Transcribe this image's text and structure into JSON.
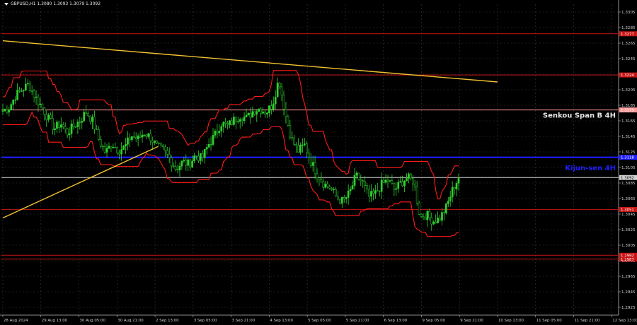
{
  "window": {
    "title": "GBPUSD,H1  1.3080 1.3093 1.3079 1.3092"
  },
  "colors": {
    "background": "#000000",
    "grid": "#3a3a3a",
    "candle": "#2fd12f",
    "kijun_line": "#1e1eff",
    "senkou_line": "#ff9a9a",
    "level_line": "#c81414",
    "trend_line": "#f2c230",
    "channel": "#ff1a1a",
    "label_bg": "#c81414",
    "axis_text": "#d0d0d0"
  },
  "chart_data": {
    "type": "candlestick",
    "symbol": "GBPUSD",
    "timeframe": "H1",
    "ohlc_header": {
      "open": 1.308,
      "high": 1.3093,
      "low": 1.3079,
      "close": 1.3092
    },
    "ylim": [
      1.2915,
      1.3315
    ],
    "y_ticks": [
      "1.3305",
      "1.3285",
      "1.3265",
      "1.3245",
      "1.3225",
      "1.3205",
      "1.3185",
      "1.3165",
      "1.3145",
      "1.3125",
      "1.3105",
      "1.3085",
      "1.3065",
      "1.3045",
      "1.3025",
      "1.3005",
      "1.2985",
      "1.2965",
      "1.2945",
      "1.2925"
    ],
    "x_ticks": [
      "28 Aug 2024",
      "29 Aug 13:00",
      "30 Aug 05:00",
      "30 Aug 21:00",
      "2 Sep 13:00",
      "3 Sep 05:00",
      "3 Sep 21:00",
      "4 Sep 13:00",
      "5 Sep 05:00",
      "5 Sep 21:00",
      "6 Sep 13:00",
      "9 Sep 05:00",
      "9 Sep 21:00",
      "10 Sep 13:00",
      "11 Sep 05:00",
      "11 Sep 21:00",
      "12 Sep 13:00"
    ],
    "close_path": [
      1.3178,
      1.3182,
      1.3198,
      1.3205,
      1.3212,
      1.3196,
      1.3184,
      1.3169,
      1.3155,
      1.3162,
      1.3149,
      1.3158,
      1.3165,
      1.3177,
      1.3164,
      1.3139,
      1.3124,
      1.3136,
      1.3127,
      1.3131,
      1.3146,
      1.3141,
      1.315,
      1.3144,
      1.3132,
      1.3127,
      1.3116,
      1.3103,
      1.3112,
      1.3109,
      1.3121,
      1.3116,
      1.3134,
      1.3146,
      1.3162,
      1.3158,
      1.3166,
      1.3172,
      1.3168,
      1.3178,
      1.3181,
      1.3176,
      1.3186,
      1.3219,
      1.3174,
      1.3141,
      1.3126,
      1.3134,
      1.3112,
      1.3096,
      1.3084,
      1.3079,
      1.3066,
      1.3061,
      1.3072,
      1.3094,
      1.3086,
      1.3067,
      1.3071,
      1.3083,
      1.3089,
      1.3076,
      1.3085,
      1.3092,
      1.3087,
      1.3041,
      1.3044,
      1.3036,
      1.3039,
      1.3052,
      1.3075,
      1.3092
    ],
    "candles_count": 220,
    "horizontal_levels": [
      {
        "price": 1.3277,
        "label": "1.3277",
        "color": "#c81414"
      },
      {
        "price": 1.3224,
        "label": "1.3224",
        "color": "#c81414"
      },
      {
        "price": 1.3179,
        "label": "1.3179",
        "color": "#ff9a9a"
      },
      {
        "price": 1.3118,
        "label": "1.3118",
        "color": "#1e1eff"
      },
      {
        "price": 1.3092,
        "label": "1.3092",
        "color": "#cfcfcf"
      },
      {
        "price": 1.3051,
        "label": "1.3051",
        "color": "#c81414"
      },
      {
        "price": 1.2992,
        "label": "1.2992",
        "color": "#c81414"
      },
      {
        "price": 1.2987,
        "label": "1.2987",
        "color": "#c81414"
      }
    ],
    "annotations": [
      {
        "text": "Senkou Span B 4H",
        "price": 1.3172,
        "color": "#e6e6e6"
      },
      {
        "text": "Kijun-sen 4H",
        "price": 1.3104,
        "color": "#1e1eff"
      }
    ],
    "trend_lines": [
      {
        "from": {
          "x_index": 0,
          "price": 1.3268
        },
        "to": {
          "x_index": 0.78,
          "price": 1.3215
        }
      },
      {
        "from": {
          "x_index": 0,
          "price": 1.304
        },
        "to": {
          "x_index": 0.245,
          "price": 1.3132
        }
      }
    ]
  }
}
